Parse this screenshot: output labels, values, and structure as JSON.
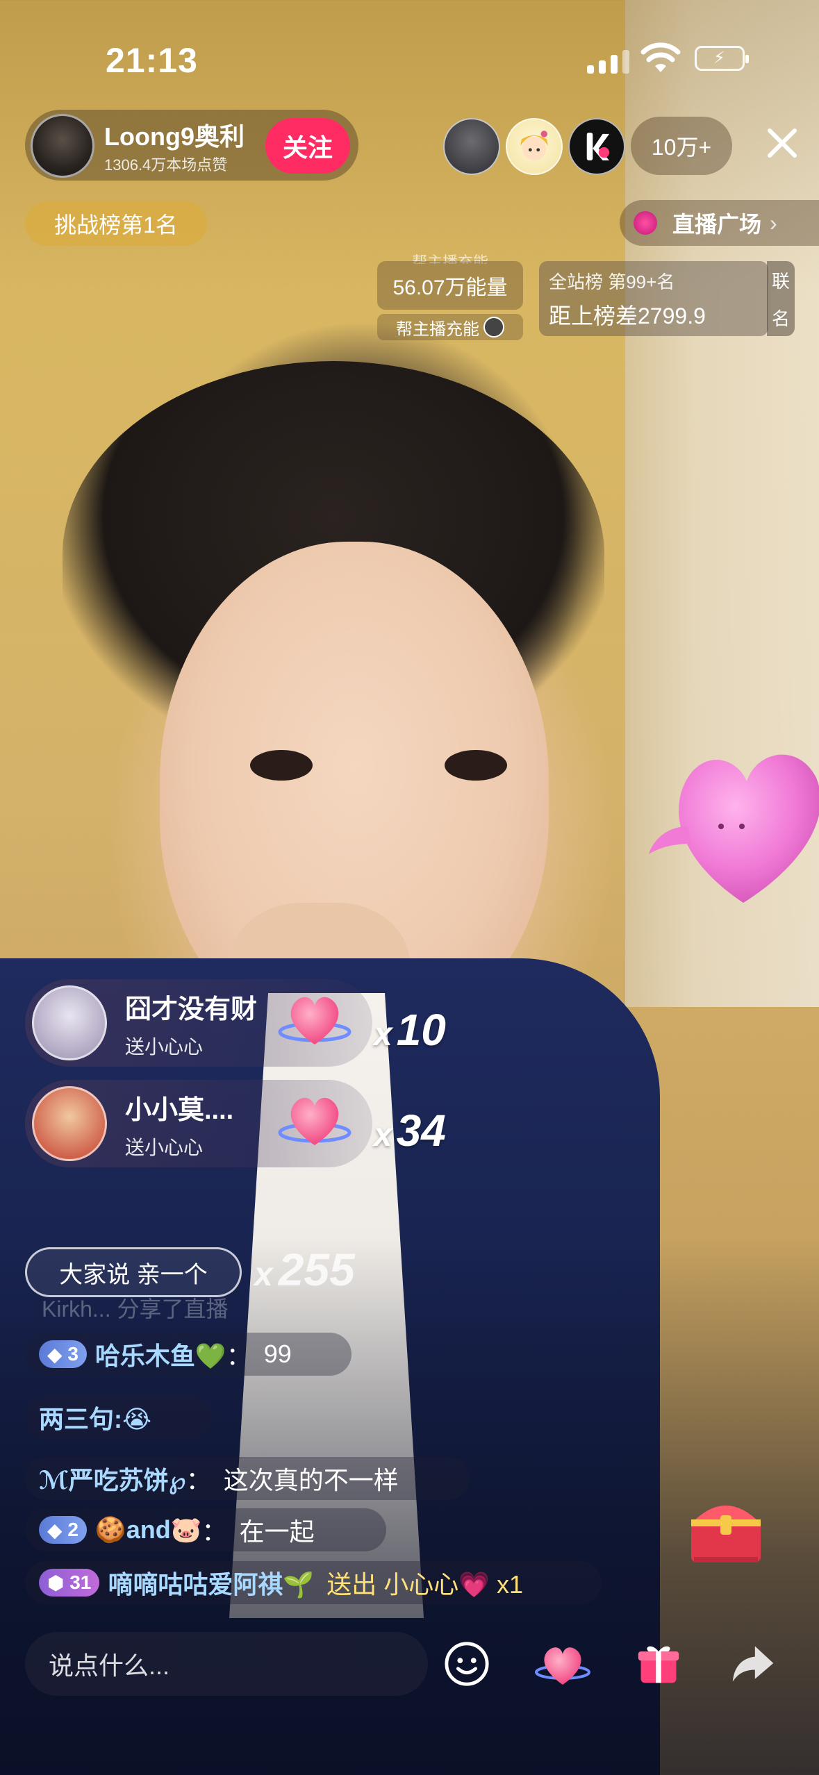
{
  "status_bar": {
    "time": "21:13"
  },
  "header": {
    "host_name": "Loong9奥利",
    "host_likes": "1306.4万本场点赞",
    "follow_label": "关注",
    "viewer_count": "10万+"
  },
  "badges": {
    "challenge": "挑战榜第1名",
    "plaza": "直播广场",
    "plaza_arrow": "›"
  },
  "energy": {
    "top_cut": "帮主播充能",
    "value": "56.07万能量",
    "sub": "帮主播充能"
  },
  "rank": {
    "line1": "全站榜 第99+名",
    "line2": "距上榜差2799.9",
    "tag_top": "联",
    "tag_bottom": "名"
  },
  "gifts": [
    {
      "user": "囧才没有财",
      "action": "送小心心",
      "times_prefix": "x",
      "times": "10"
    },
    {
      "user": "小小莫....",
      "action": "送小心心",
      "times_prefix": "x",
      "times": "34"
    }
  ],
  "everyone_says": {
    "label": "大家说  亲一个",
    "prefix": "x",
    "count": "255"
  },
  "ghost_line": "Kirkh...  分享了直播",
  "chat": [
    {
      "level": "3",
      "name": "哈乐木鱼💚",
      "sep": "：",
      "message": "99"
    },
    {
      "name": "两三句:😭"
    },
    {
      "name": "ℳ严吃苏饼℘",
      "sep": "：",
      "message": "这次真的不一样"
    },
    {
      "level": "2",
      "name": "🍪and🐷",
      "sep": "：",
      "message": "在一起"
    },
    {
      "level": "31",
      "name": "嘀嘀咕咕爱阿祺🌱",
      "message": "送出 小心心💗 x1"
    }
  ],
  "bottom_bar": {
    "input_placeholder": "说点什么..."
  },
  "icons": {
    "close": "close-icon",
    "emoji": "emoji-icon",
    "heart": "heart-icon",
    "gift": "gift-icon",
    "share": "share-icon",
    "treasure": "treasure-chest-icon"
  },
  "colors": {
    "follow": "#fe2c63",
    "chat_name": "#a9d9ff"
  }
}
